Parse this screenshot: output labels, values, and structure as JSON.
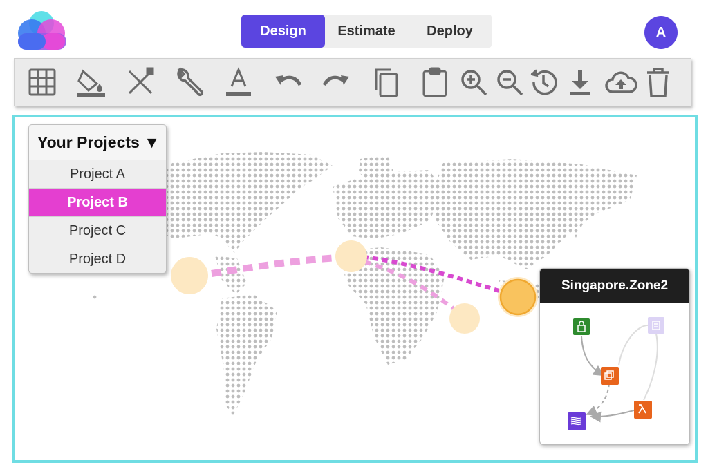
{
  "header": {
    "logo_icon": "cloud-logo-icon",
    "tabs": [
      {
        "label": "Design",
        "active": true
      },
      {
        "label": "Estimate",
        "active": false
      },
      {
        "label": "Deploy",
        "active": false
      }
    ],
    "avatar_initial": "A"
  },
  "toolbar": {
    "tools": [
      "grid-icon",
      "paint-bucket-icon",
      "edit-tools-icon",
      "wrench-icon",
      "text-color-icon",
      "undo-icon",
      "redo-icon",
      "copy-icon",
      "clipboard-icon",
      "zoom-in-icon",
      "zoom-out-icon",
      "history-icon",
      "download-icon",
      "cloud-upload-icon",
      "trash-icon"
    ]
  },
  "projects": {
    "title": "Your Projects ▼",
    "items": [
      "Project A",
      "Project B",
      "Project C",
      "Project D"
    ],
    "selected": "Project B"
  },
  "zone_panel": {
    "title": "Singapore.Zone2",
    "services": [
      "security-service-icon",
      "queue-service-icon",
      "compute-service-icon",
      "lambda-icon",
      "data-stream-icon"
    ]
  },
  "colors": {
    "accent": "#5b45e0",
    "selected": "#e43fd0",
    "canvas_border": "#6fdde3",
    "node": "#fde8c2",
    "node_active": "#f9c35e"
  }
}
